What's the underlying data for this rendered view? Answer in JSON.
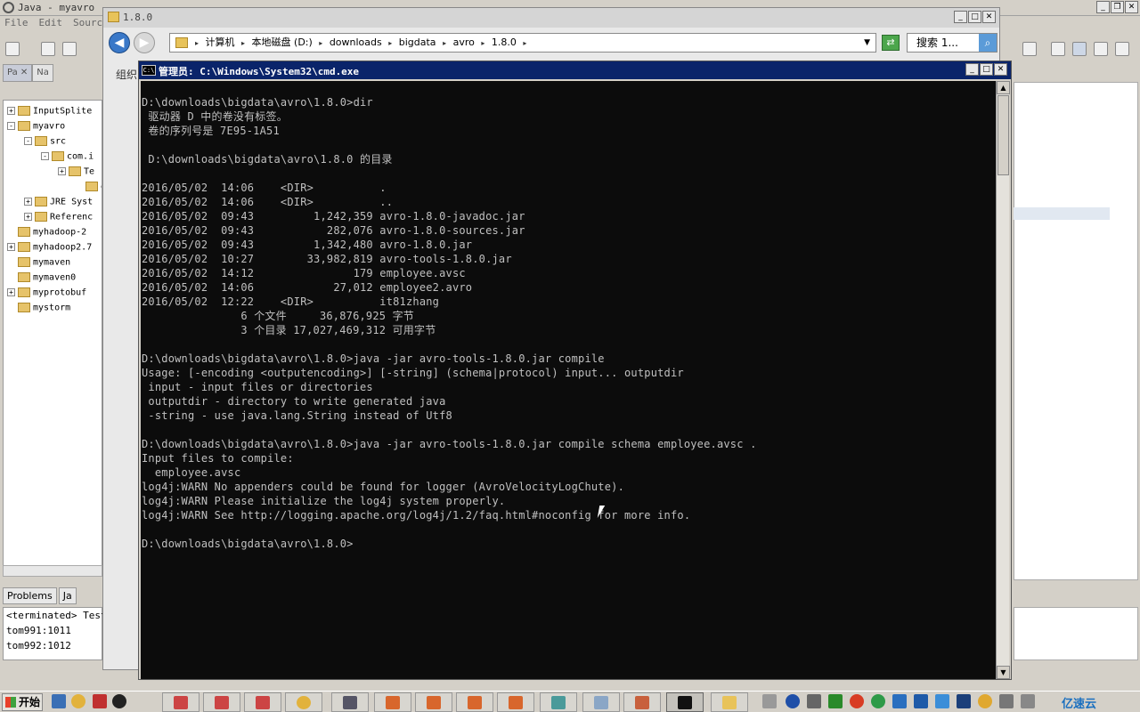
{
  "eclipse": {
    "title": "Java - myavro",
    "menu": [
      "File",
      "Edit",
      "Source"
    ],
    "tabs": [
      "Pa",
      "Na"
    ],
    "tree": [
      {
        "label": "InputSplite",
        "indent": 0,
        "expander": "+"
      },
      {
        "label": "myavro",
        "indent": 0,
        "expander": "-"
      },
      {
        "label": "src",
        "indent": 1,
        "expander": "-"
      },
      {
        "label": "com.i",
        "indent": 2,
        "expander": "-"
      },
      {
        "label": "Te",
        "indent": 3,
        "expander": "+"
      },
      {
        "label": "er",
        "indent": 4,
        "expander": ""
      },
      {
        "label": "JRE Syst",
        "indent": 1,
        "expander": "+"
      },
      {
        "label": "Referenc",
        "indent": 1,
        "expander": "+"
      },
      {
        "label": "myhadoop-2",
        "indent": 0,
        "expander": ""
      },
      {
        "label": "myhadoop2.7",
        "indent": 0,
        "expander": "+"
      },
      {
        "label": "mymaven",
        "indent": 0,
        "expander": ""
      },
      {
        "label": "mymaven0",
        "indent": 0,
        "expander": ""
      },
      {
        "label": "myprotobuf",
        "indent": 0,
        "expander": "+"
      },
      {
        "label": "mystorm",
        "indent": 0,
        "expander": ""
      }
    ],
    "console_tabs": [
      "Problems",
      "Ja"
    ],
    "console_lines": [
      "<terminated> TestA",
      "tom991:1011",
      "tom992:1012"
    ]
  },
  "explorer": {
    "title": "1.8.0",
    "breadcrumbs": [
      "计算机",
      "本地磁盘 (D:)",
      "downloads",
      "bigdata",
      "avro",
      "1.8.0"
    ],
    "search_placeholder": "搜索 1...",
    "organize_label": "组织"
  },
  "cmd": {
    "title": "管理员: C:\\Windows\\System32\\cmd.exe",
    "icon_text": "C:\\",
    "lines": [
      "",
      "D:\\downloads\\bigdata\\avro\\1.8.0>dir",
      " 驱动器 D 中的卷没有标签。",
      " 卷的序列号是 7E95-1A51",
      "",
      " D:\\downloads\\bigdata\\avro\\1.8.0 的目录",
      "",
      "2016/05/02  14:06    <DIR>          .",
      "2016/05/02  14:06    <DIR>          ..",
      "2016/05/02  09:43         1,242,359 avro-1.8.0-javadoc.jar",
      "2016/05/02  09:43           282,076 avro-1.8.0-sources.jar",
      "2016/05/02  09:43         1,342,480 avro-1.8.0.jar",
      "2016/05/02  10:27        33,982,819 avro-tools-1.8.0.jar",
      "2016/05/02  14:12               179 employee.avsc",
      "2016/05/02  14:06            27,012 employee2.avro",
      "2016/05/02  12:22    <DIR>          it81zhang",
      "               6 个文件     36,876,925 字节",
      "               3 个目录 17,027,469,312 可用字节",
      "",
      "D:\\downloads\\bigdata\\avro\\1.8.0>java -jar avro-tools-1.8.0.jar compile",
      "Usage: [-encoding <outputencoding>] [-string] (schema|protocol) input... outputdir",
      " input - input files or directories",
      " outputdir - directory to write generated java",
      " -string - use java.lang.String instead of Utf8",
      "",
      "D:\\downloads\\bigdata\\avro\\1.8.0>java -jar avro-tools-1.8.0.jar compile schema employee.avsc .",
      "Input files to compile:",
      "  employee.avsc",
      "log4j:WARN No appenders could be found for logger (AvroVelocityLogChute).",
      "log4j:WARN Please initialize the log4j system properly.",
      "log4j:WARN See http://logging.apache.org/log4j/1.2/faq.html#noconfig for more info.",
      "",
      "D:\\downloads\\bigdata\\avro\\1.8.0>"
    ]
  },
  "taskbar": {
    "start_label": "开始",
    "watermark": "亿速云"
  },
  "colors": {
    "cmd_bg": "#0c0c0c",
    "cmd_fg": "#c0c0c0",
    "title_active": "#0a246a"
  }
}
